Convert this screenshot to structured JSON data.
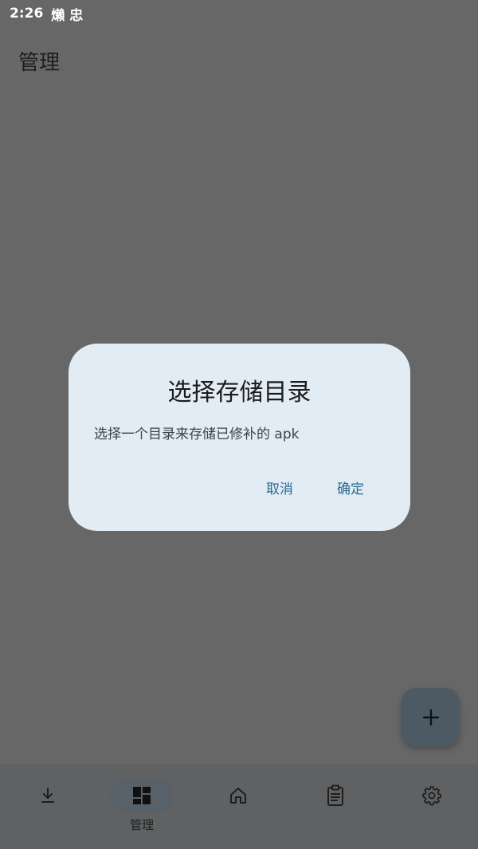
{
  "status_bar": {
    "time": "2:26",
    "icons": [
      "status-icon-1",
      "status-icon-2"
    ],
    "glyphs": [
      "㸊",
      "忠"
    ]
  },
  "header": {
    "title": "管理"
  },
  "dialog": {
    "title": "选择存储目录",
    "message": "选择一个目录来存储已修补的 apk",
    "cancel_label": "取消",
    "ok_label": "确定"
  },
  "fab": {
    "icon": "add-icon"
  },
  "bottom_nav": {
    "items": [
      {
        "icon": "download-icon",
        "label": ""
      },
      {
        "icon": "grid-icon",
        "label": "管理",
        "active": true
      },
      {
        "icon": "home-icon",
        "label": ""
      },
      {
        "icon": "clipboard-icon",
        "label": ""
      },
      {
        "icon": "settings-icon",
        "label": ""
      }
    ]
  },
  "colors": {
    "scrim_background": "#676767",
    "dialog_background": "#e1ecf5",
    "accent_text": "#2b6a8f",
    "fab_background": "#4d5a64",
    "nav_background": "#5f6163"
  }
}
